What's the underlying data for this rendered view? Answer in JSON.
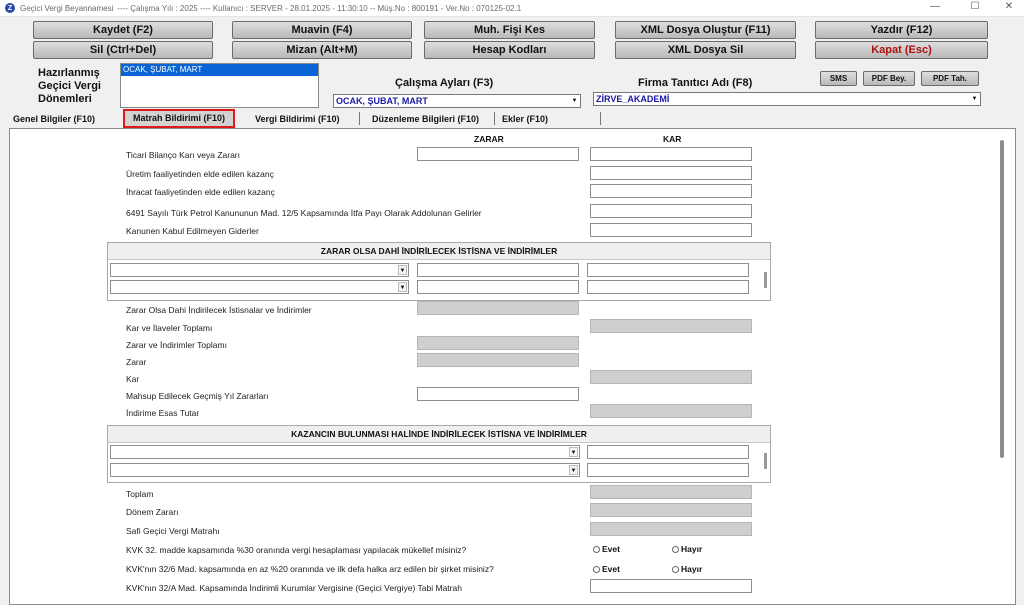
{
  "window": {
    "title": "Geçici Vergi Beyannamesi",
    "info": "----  Çalışma Yılı : 2025  ----  Kullanıcı : SERVER - 28.01.2025 - 11:30:10 -- Müş.No : 800191 - Ver.No : 070125-02.1",
    "minimize": "—",
    "maximize": "☐",
    "close": "✕"
  },
  "toolbar": {
    "kaydet": "Kaydet (F2)",
    "muavin": "Muavin (F4)",
    "muh_fisi": "Muh. Fişi Kes",
    "xml_olustur": "XML Dosya Oluştur (F11)",
    "yazdir": "Yazdır (F12)",
    "sil": "Sil (Ctrl+Del)",
    "mizan": "Mizan (Alt+M)",
    "hesap_kodlari": "Hesap Kodları",
    "xml_sil": "XML Dosya Sil",
    "kapat": "Kapat (Esc)",
    "sms": "SMS",
    "pdf_bey": "PDF Bey.",
    "pdf_tah": "PDF Tah."
  },
  "header": {
    "hazirlanmis_1": "Hazırlanmış",
    "hazirlanmis_2": "Geçici Vergi",
    "hazirlanmis_3": "Dönemleri",
    "list_selected": "OCAK, ŞUBAT, MART",
    "calisma_aylari_label": "Çalışma Ayları (F3)",
    "calisma_aylari_value": "OCAK, ŞUBAT, MART",
    "firma_label": "Firma Tanıtıcı Adı (F8)",
    "firma_value": "ZİRVE_AKADEMİ"
  },
  "tabs": {
    "genel": "Genel Bilgiler (F10)",
    "matrah": "Matrah Bildirimi (F10)",
    "vergi": "Vergi Bildirimi (F10)",
    "duzenleme": "Düzenleme Bilgileri (F10)",
    "ekler": "Ekler (F10)"
  },
  "form": {
    "col_zarar": "ZARAR",
    "col_kar": "KAR",
    "r1": "Ticari Bilanço Karı veya Zararı",
    "r2": "Üretim faaliyetinden elde edilen kazanç",
    "r3": "İhracat faaliyetinden elde edilen kazanç",
    "r4": "6491 Sayılı Türk Petrol Kanununun Mad. 12/5 Kapsamında İtfa Payı Olarak Addolunan Gelirler",
    "r5": "Kanunen Kabul Edilmeyen Giderler",
    "group1_title": "ZARAR OLSA DAHİ İNDİRİLECEK İSTİSNA VE İNDİRİMLER",
    "r6": "Zarar Olsa Dahi İndirilecek İstisnalar ve İndirimler",
    "r7": "Kar ve İlaveler Toplamı",
    "r8": "Zarar ve İndirimler Toplamı",
    "r9": "Zarar",
    "r10": "Kar",
    "r11": "Mahsup Edilecek Geçmiş Yıl Zararları",
    "r12": "İndirime Esas Tutar",
    "group2_title": "KAZANCIN BULUNMASI HALİNDE İNDİRİLECEK İSTİSNA VE İNDİRİMLER",
    "r13": "Toplam",
    "r14": "Dönem Zararı",
    "r15": "Safi Geçici Vergi Matrahı",
    "q1": "KVK 32. madde kapsamında %30 oranında vergi hesaplaması yapılacak mükellef misiniz?",
    "q2": "KVK'nın 32/6 Mad. kapsamında en az %20 oranında ve ilk defa halka arz edilen bir şirket misiniz?",
    "q3": "KVK'nın 32/A Mad. Kapsamında İndirimli Kurumlar Vergisine (Geçici Vergiye) Tabi Matrah",
    "evet": "Evet",
    "hayir": "Hayır"
  },
  "colors": {
    "accent_red": "#e01a1a",
    "list_selection": "#0a64d6",
    "combo_text": "#1a1aa0"
  }
}
